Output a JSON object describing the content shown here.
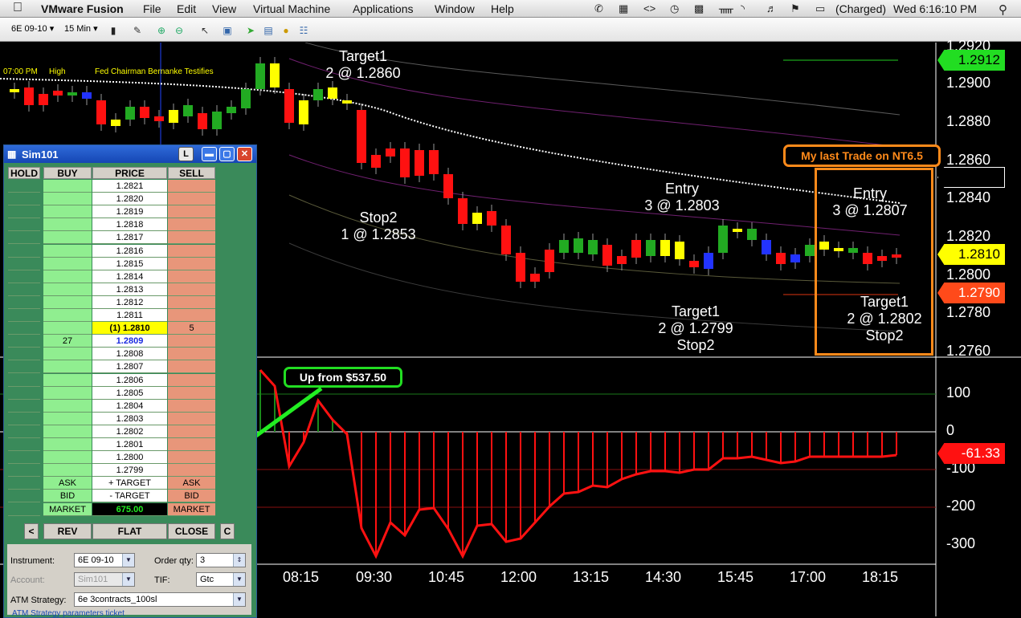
{
  "menubar": {
    "app_name": "VMware Fusion",
    "items": [
      "File",
      "Edit",
      "View",
      "Virtual Machine",
      "Applications",
      "Window",
      "Help"
    ],
    "battery": "(Charged)",
    "clock": "Wed 6:16:10 PM"
  },
  "toolbar": {
    "instrument": "6E 09-10",
    "interval": "15 Min"
  },
  "chart": {
    "top_text": {
      "time": "07:00 PM",
      "high": "High",
      "event": "Fed Chairman Bernanke Testifies"
    },
    "price_axis": [
      "1.2920",
      "1.2900",
      "1.2880",
      "1.2860",
      "1.2840",
      "1.2820",
      "1.2800",
      "1.2780",
      "1.2760"
    ],
    "price_tags": [
      {
        "label": "1.2912",
        "bg": "#22dd22",
        "fg": "#000000"
      },
      {
        "label": "1.2810",
        "bg": "#ffff00",
        "fg": "#000000"
      },
      {
        "label": "1.2790",
        "bg": "#ff4a1a",
        "fg": "#ffffff"
      }
    ],
    "indicator_axis": [
      "100",
      "0",
      "-100",
      "-200",
      "-300"
    ],
    "indicator_tag": {
      "label": "-61.33",
      "bg": "#ff1111",
      "fg": "#ffffff"
    },
    "time_axis": [
      "08:15",
      "09:30",
      "10:45",
      "12:00",
      "13:15",
      "14:30",
      "15:45",
      "17:00",
      "18:15"
    ],
    "annotations": {
      "target1_a_title": "Target1",
      "target1_a_detail": "2 @ 1.2860",
      "stop2_a_title": "Stop2",
      "stop2_a_detail": "1 @ 1.2853",
      "entry_b_title": "Entry",
      "entry_b_detail": "3 @ 1.2803",
      "target1_b_title": "Target1",
      "target1_b_detail": "2 @ 1.2799",
      "stop2_b_title": "Stop2",
      "entry_c_title": "Entry",
      "entry_c_detail": "3 @ 1.2807",
      "target1_c_title": "Target1",
      "target1_c_detail": "2 @ 1.2802",
      "stop2_c_title": "Stop2"
    },
    "callout_green": "Up from $537.50",
    "callout_orange": "My last Trade on NT6.5"
  },
  "sim_window": {
    "title": "Sim101",
    "lock_label": "L",
    "headers": {
      "hold": "HOLD",
      "buy": "BUY",
      "price": "PRICE",
      "sell": "SELL"
    },
    "ladder": [
      {
        "price": "1.2821",
        "buy": "",
        "sell": ""
      },
      {
        "price": "1.2820",
        "buy": "",
        "sell": ""
      },
      {
        "price": "1.2819",
        "buy": "",
        "sell": ""
      },
      {
        "price": "1.2818",
        "buy": "",
        "sell": ""
      },
      {
        "price": "1.2817",
        "buy": "",
        "sell": ""
      },
      {
        "price": "1.2816",
        "buy": "",
        "sell": ""
      },
      {
        "price": "1.2815",
        "buy": "",
        "sell": ""
      },
      {
        "price": "1.2814",
        "buy": "",
        "sell": ""
      },
      {
        "price": "1.2813",
        "buy": "",
        "sell": ""
      },
      {
        "price": "1.2812",
        "buy": "",
        "sell": ""
      },
      {
        "price": "1.2811",
        "buy": "",
        "sell": ""
      },
      {
        "price": "(1) 1.2810",
        "buy": "",
        "sell": "5"
      },
      {
        "price": "1.2809",
        "buy": "27",
        "sell": ""
      },
      {
        "price": "1.2808",
        "buy": "",
        "sell": ""
      },
      {
        "price": "1.2807",
        "buy": "",
        "sell": ""
      },
      {
        "price": "1.2806",
        "buy": "",
        "sell": ""
      },
      {
        "price": "1.2805",
        "buy": "",
        "sell": ""
      },
      {
        "price": "1.2804",
        "buy": "",
        "sell": ""
      },
      {
        "price": "1.2803",
        "buy": "",
        "sell": ""
      },
      {
        "price": "1.2802",
        "buy": "",
        "sell": ""
      },
      {
        "price": "1.2801",
        "buy": "",
        "sell": ""
      },
      {
        "price": "1.2800",
        "buy": "",
        "sell": ""
      },
      {
        "price": "1.2799",
        "buy": "",
        "sell": ""
      }
    ],
    "row_ask": {
      "buy": "ASK",
      "price": "+ TARGET",
      "sell": "ASK"
    },
    "row_bid": {
      "buy": "BID",
      "price": "- TARGET",
      "sell": "BID"
    },
    "row_market": {
      "buy": "MARKET",
      "price": "675.00",
      "sell": "MARKET"
    },
    "buttons": {
      "left": "<",
      "rev": "REV",
      "flat": "FLAT",
      "close": "CLOSE",
      "right": "C"
    },
    "fields": {
      "instrument_label": "Instrument:",
      "instrument_value": "6E 09-10",
      "order_qty_label": "Order qty:",
      "order_qty_value": "3",
      "account_label": "Account:",
      "account_value": "Sim101",
      "tif_label": "TIF:",
      "tif_value": "Gtc",
      "atm_label": "ATM Strategy:",
      "atm_value": "6e 3contracts_100sl",
      "atm_params": "ATM Strategy parameters ticket"
    }
  }
}
